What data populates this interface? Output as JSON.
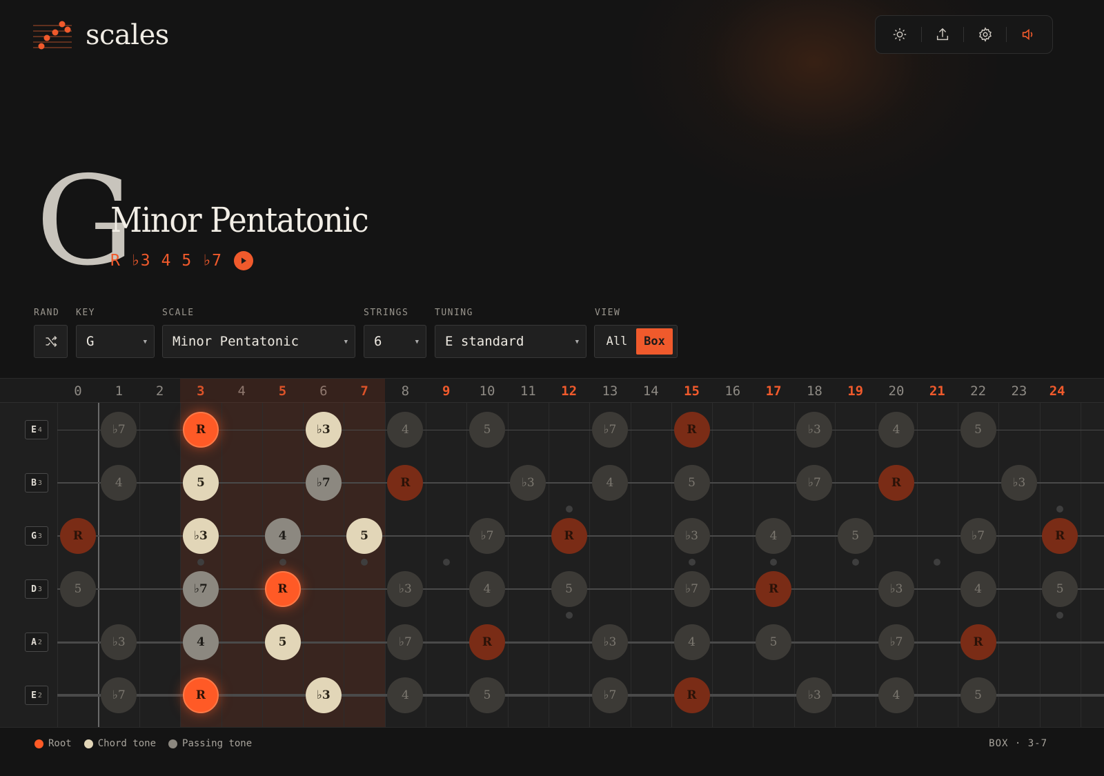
{
  "app": {
    "title": "scales"
  },
  "header": {
    "toolbar": [
      {
        "name": "theme-button",
        "icon": "sun-icon"
      },
      {
        "name": "share-button",
        "icon": "share-icon"
      },
      {
        "name": "settings-button",
        "icon": "gear-icon"
      },
      {
        "name": "sound-button",
        "icon": "speaker-icon"
      }
    ]
  },
  "scale": {
    "key": "G",
    "name": "Minor Pentatonic",
    "intervals": [
      "R",
      "♭3",
      "4",
      "5",
      "♭7"
    ]
  },
  "controls": {
    "rand": {
      "label": "RAND"
    },
    "key": {
      "label": "KEY",
      "value": "G"
    },
    "scale": {
      "label": "SCALE",
      "value": "Minor Pentatonic"
    },
    "strings": {
      "label": "STRINGS",
      "value": "6"
    },
    "tuning": {
      "label": "TUNING",
      "value": "E standard"
    },
    "view": {
      "label": "VIEW",
      "options": [
        "All",
        "Box"
      ],
      "selected": "Box"
    }
  },
  "fretboard": {
    "frets": [
      "0",
      "1",
      "2",
      "3",
      "4",
      "5",
      "6",
      "7",
      "8",
      "9",
      "10",
      "11",
      "12",
      "13",
      "14",
      "15",
      "16",
      "17",
      "18",
      "19",
      "20",
      "21",
      "22",
      "23",
      "24"
    ],
    "highlighted_frets": [
      3,
      5,
      7,
      9,
      12,
      15,
      17,
      19,
      21,
      24
    ],
    "box_range": [
      3,
      7
    ],
    "strings": [
      {
        "note": "E",
        "octave": "4",
        "notes": [
          [
            1,
            "♭7"
          ],
          [
            3,
            "R"
          ],
          [
            6,
            "♭3"
          ],
          [
            8,
            "4"
          ],
          [
            10,
            "5"
          ],
          [
            13,
            "♭7"
          ],
          [
            15,
            "R"
          ],
          [
            18,
            "♭3"
          ],
          [
            20,
            "4"
          ],
          [
            22,
            "5"
          ]
        ]
      },
      {
        "note": "B",
        "octave": "3",
        "notes": [
          [
            1,
            "4"
          ],
          [
            3,
            "5"
          ],
          [
            6,
            "♭7"
          ],
          [
            8,
            "R"
          ],
          [
            11,
            "♭3"
          ],
          [
            13,
            "4"
          ],
          [
            15,
            "5"
          ],
          [
            18,
            "♭7"
          ],
          [
            20,
            "R"
          ],
          [
            23,
            "♭3"
          ]
        ]
      },
      {
        "note": "G",
        "octave": "3",
        "notes": [
          [
            0,
            "R"
          ],
          [
            3,
            "♭3"
          ],
          [
            5,
            "4"
          ],
          [
            7,
            "5"
          ],
          [
            10,
            "♭7"
          ],
          [
            12,
            "R"
          ],
          [
            15,
            "♭3"
          ],
          [
            17,
            "4"
          ],
          [
            19,
            "5"
          ],
          [
            22,
            "♭7"
          ],
          [
            24,
            "R"
          ]
        ]
      },
      {
        "note": "D",
        "octave": "3",
        "notes": [
          [
            0,
            "5"
          ],
          [
            3,
            "♭7"
          ],
          [
            5,
            "R"
          ],
          [
            8,
            "♭3"
          ],
          [
            10,
            "4"
          ],
          [
            12,
            "5"
          ],
          [
            15,
            "♭7"
          ],
          [
            17,
            "R"
          ],
          [
            20,
            "♭3"
          ],
          [
            22,
            "4"
          ],
          [
            24,
            "5"
          ]
        ]
      },
      {
        "note": "A",
        "octave": "2",
        "notes": [
          [
            1,
            "♭3"
          ],
          [
            3,
            "4"
          ],
          [
            5,
            "5"
          ],
          [
            8,
            "♭7"
          ],
          [
            10,
            "R"
          ],
          [
            13,
            "♭3"
          ],
          [
            15,
            "4"
          ],
          [
            17,
            "5"
          ],
          [
            20,
            "♭7"
          ],
          [
            22,
            "R"
          ]
        ]
      },
      {
        "note": "E",
        "octave": "2",
        "notes": [
          [
            1,
            "♭7"
          ],
          [
            3,
            "R"
          ],
          [
            6,
            "♭3"
          ],
          [
            8,
            "4"
          ],
          [
            10,
            "5"
          ],
          [
            13,
            "♭7"
          ],
          [
            15,
            "R"
          ],
          [
            18,
            "♭3"
          ],
          [
            20,
            "4"
          ],
          [
            22,
            "5"
          ]
        ]
      }
    ]
  },
  "legend": [
    {
      "label": "Root",
      "color": "#ff5a26"
    },
    {
      "label": "Chord tone",
      "color": "#e2d6b8"
    },
    {
      "label": "Passing tone",
      "color": "#8c8880"
    }
  ],
  "footer": {
    "box_info": "BOX · 3-7"
  },
  "colors": {
    "accent": "#f05a2c",
    "background": "#141414"
  }
}
